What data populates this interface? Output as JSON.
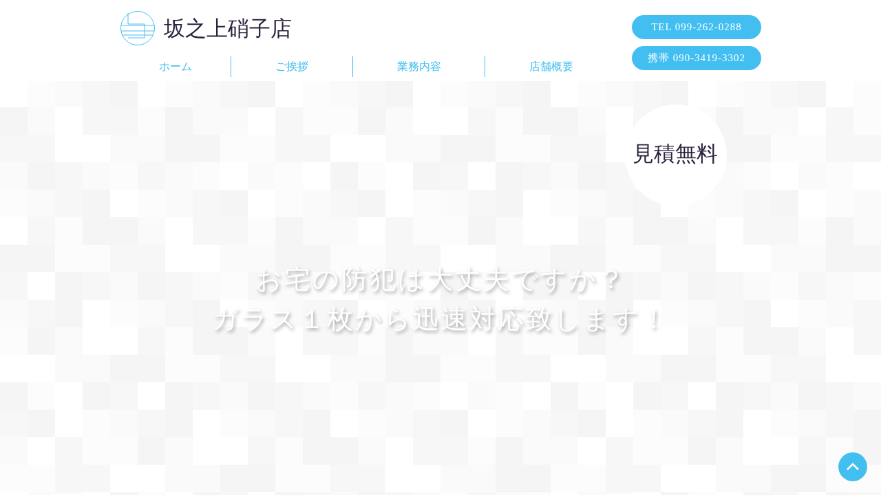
{
  "header": {
    "shop_name": "坂之上硝子店",
    "contact_buttons": [
      "TEL 099-262-0288",
      "携帯 090-3419-3302"
    ]
  },
  "nav": {
    "items": [
      "ホーム",
      "ご挨拶",
      "業務内容",
      "店舗概要"
    ]
  },
  "hero": {
    "badge": "見積無料",
    "headline_lines": [
      "お宅の防犯は大丈夫ですか？",
      "ガラス１枚から迅速対応致します！"
    ]
  }
}
